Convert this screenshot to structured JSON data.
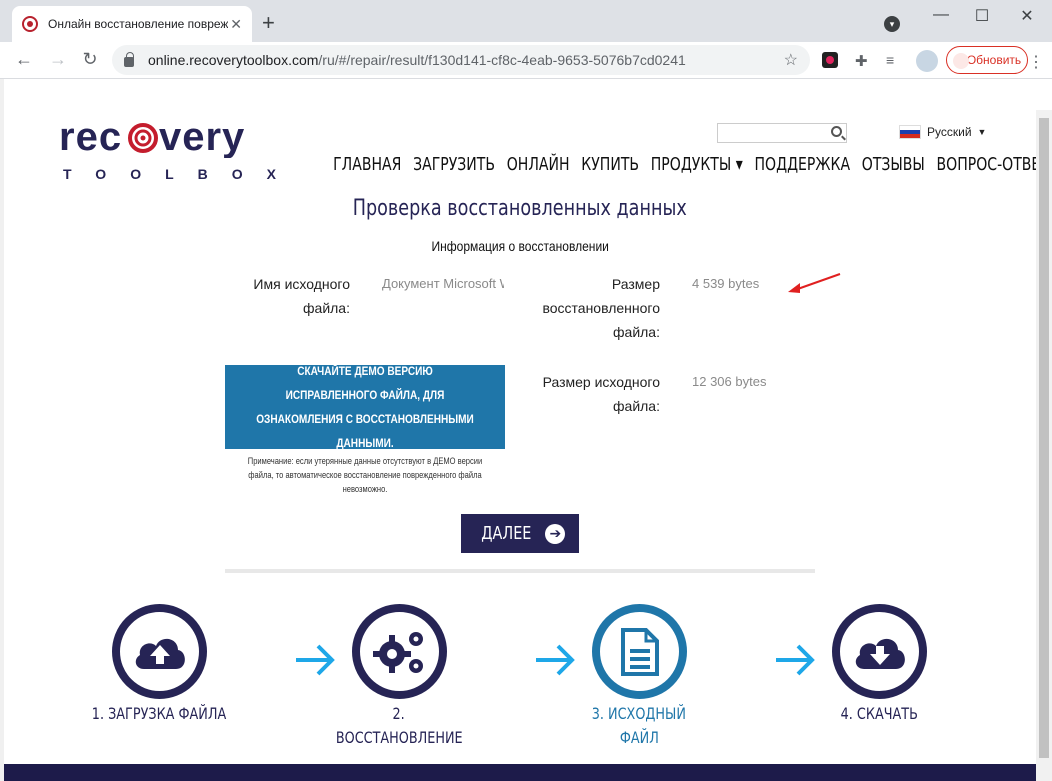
{
  "browser": {
    "tab_title": "Онлайн восстановление поврежд",
    "tab_close": "✕",
    "new_tab": "+",
    "url_host": "online.recoverytoolbox.com",
    "url_path": "/ru/#/repair/result/f130d141-cf8c-4eab-9653-5076b7cd0241",
    "update_button": "Обновить",
    "window_minimize": "—",
    "window_maximize": "☐",
    "window_close": "✕"
  },
  "header": {
    "logo_text": "recovery",
    "logo_subtext": "TOOLBOX",
    "search_placeholder": "",
    "language": "Русский",
    "nav": [
      "ГЛАВНАЯ",
      "ЗАГРУЗИТЬ",
      "ОНЛАЙН",
      "КУПИТЬ",
      "ПРОДУКТЫ ▾",
      "ПОДДЕРЖКА",
      "ОТЗЫВЫ",
      "ВОПРОС-ОТВЕТ"
    ]
  },
  "main": {
    "title": "Проверка восстановленных данных",
    "subtitle": "Информация о восстановлении",
    "source_name_label_1": "Имя исходного",
    "source_name_label_2": "файла:",
    "source_name_value": "Документ Microsoft Word",
    "recovered_size_label_1": "Размер",
    "recovered_size_label_2": "восстановленного",
    "recovered_size_label_3": "файла:",
    "recovered_size_value": "4 539 bytes",
    "source_size_label_1": "Размер исходного",
    "source_size_label_2": "файла:",
    "source_size_value": "12 306 bytes",
    "demo_button": "СКАЧАЙТЕ ДЕМО ВЕРСИЮ ИСПРАВЛЕННОГО ФАЙЛА, ДЛЯ ОЗНАКОМЛЕНИЯ С ВОССТАНОВЛЕННЫМИ ДАННЫМИ.",
    "note": "Примечание: если утерянные данные отсутствуют в ДЕМО версии файла, то автоматическое восстановление поврежденного файла невозможно.",
    "next_button": "ДАЛЕЕ"
  },
  "steps": [
    {
      "label_1": "1. ЗАГРУЗКА ФАЙЛА",
      "label_2": "",
      "icon": "cloud-upload-icon"
    },
    {
      "label_1": "2.",
      "label_2": "ВОССТАНОВЛЕНИЕ",
      "icon": "gears-icon"
    },
    {
      "label_1": "3. ИСХОДНЫЙ",
      "label_2": "ФАЙЛ",
      "icon": "document-icon"
    },
    {
      "label_1": "4. СКАЧАТЬ",
      "label_2": "",
      "icon": "cloud-download-icon"
    }
  ],
  "colors": {
    "brand_navy": "#262455",
    "brand_red": "#c41d2d",
    "active_blue": "#1f76a9",
    "arrow_blue": "#1ea7e8",
    "update_red": "#d93025"
  }
}
